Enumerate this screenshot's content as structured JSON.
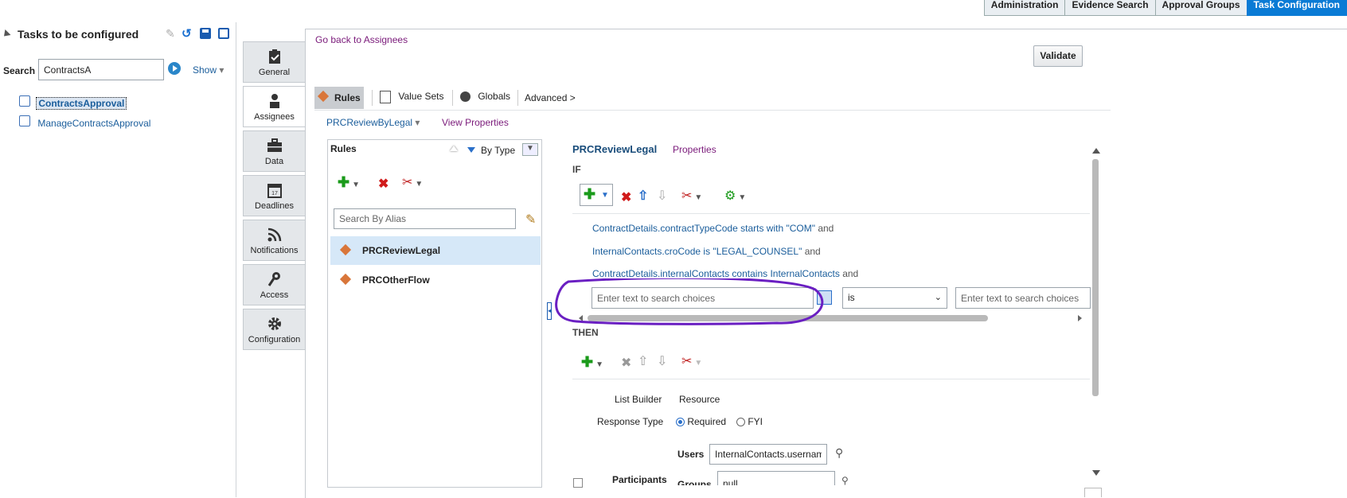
{
  "topnav": {
    "tabs": [
      "Administration",
      "Evidence Search",
      "Approval Groups",
      "Task Configuration"
    ],
    "active_index": 3
  },
  "left": {
    "title": "Tasks to be configured",
    "search_label": "Search",
    "search_value": "ContractsA",
    "show_label": "Show",
    "tasks": [
      "ContractsApproval",
      "ManageContractsApproval"
    ]
  },
  "vtabs": [
    "General",
    "Assignees",
    "Data",
    "Deadlines",
    "Notifications",
    "Access",
    "Configuration"
  ],
  "main": {
    "back_link": "Go back to Assignees",
    "validate": "Validate",
    "subtabs": [
      "Rules",
      "Value Sets",
      "Globals",
      "Advanced >"
    ],
    "ruleset_name": "PRCReviewByLegal",
    "view_properties": "View Properties"
  },
  "rules": {
    "header": "Rules",
    "sort_label": "By Type",
    "search_placeholder": "Search By Alias",
    "items": [
      "PRCReviewLegal",
      "PRCOtherFlow"
    ]
  },
  "editor": {
    "rule_name": "PRCReviewLegal",
    "properties": "Properties",
    "if_label": "IF",
    "then_label": "THEN",
    "conditions": [
      {
        "left": "ContractDetails.contractTypeCode",
        "op": "starts with",
        "right": "\"COM\"",
        "conj": "and"
      },
      {
        "left": "InternalContacts.croCode",
        "op": "is",
        "right": "\"LEGAL_COUNSEL\"",
        "conj": "and"
      },
      {
        "left": "ContractDetails.internalContacts",
        "op": "contains",
        "right": "InternalContacts",
        "conj": "and"
      }
    ],
    "new_left_placeholder": "Enter text to search choices",
    "new_op": "is",
    "new_right_placeholder": "Enter text to search choices",
    "list_builder_label": "List Builder",
    "list_builder_value": "Resource",
    "response_type_label": "Response Type",
    "response_required": "Required",
    "response_fyi": "FYI",
    "users_label": "Users",
    "users_value": "InternalContacts.usernam",
    "participants_label": "Participants",
    "groups_label": "Groups",
    "groups_value": "null"
  },
  "annotation_color": "#6a1fc2"
}
